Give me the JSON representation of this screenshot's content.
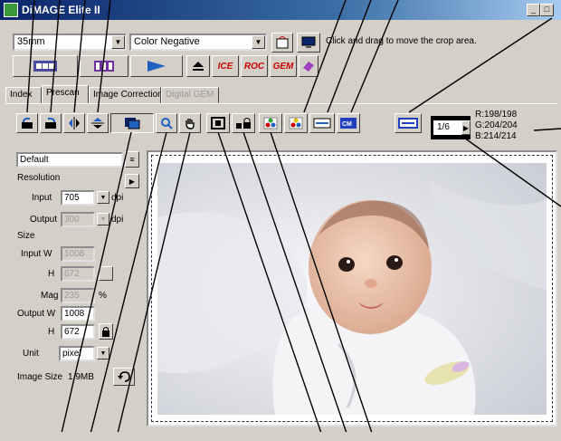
{
  "window": {
    "title": "DiMAGE Elite II"
  },
  "toolbar_top": {
    "film_format": "35mm",
    "film_type": "Color Negative",
    "status_message": "Click and drag to move the crop area.",
    "feature_buttons": [
      "ICE",
      "ROC",
      "GEM"
    ]
  },
  "tabs": [
    {
      "label": "Index",
      "state": "normal"
    },
    {
      "label": "Prescan",
      "state": "active"
    },
    {
      "label": "Image Correction",
      "state": "normal"
    },
    {
      "label": "Digital GEM",
      "state": "disabled"
    }
  ],
  "settings_panel": {
    "preset": "Default",
    "resolution_label": "Resolution",
    "input_label": "Input",
    "input_value": "705",
    "input_unit": "dpi",
    "output_label": "Output",
    "output_value": "300",
    "output_unit": "dpi",
    "size_label": "Size",
    "input_w_label": "Input W",
    "input_w_value": "1008",
    "h_label": "H",
    "input_h_value": "672",
    "mag_label": "Mag",
    "mag_value": "235",
    "mag_unit": "%",
    "output_w_label": "Output W",
    "output_w_value": "1008",
    "output_h_value": "672",
    "unit_label": "Unit",
    "unit_value": "pixel",
    "image_size_label": "Image Size",
    "image_size_value": "1.9MB"
  },
  "frame_counter": {
    "value": "1/6"
  },
  "rgb_readout": {
    "r": "R:198/198",
    "g": "G:204/204",
    "b": "B:214/214"
  },
  "colors": {
    "title_start": "#0a246a",
    "title_end": "#a6caf0",
    "face": "#d4d0c8"
  }
}
